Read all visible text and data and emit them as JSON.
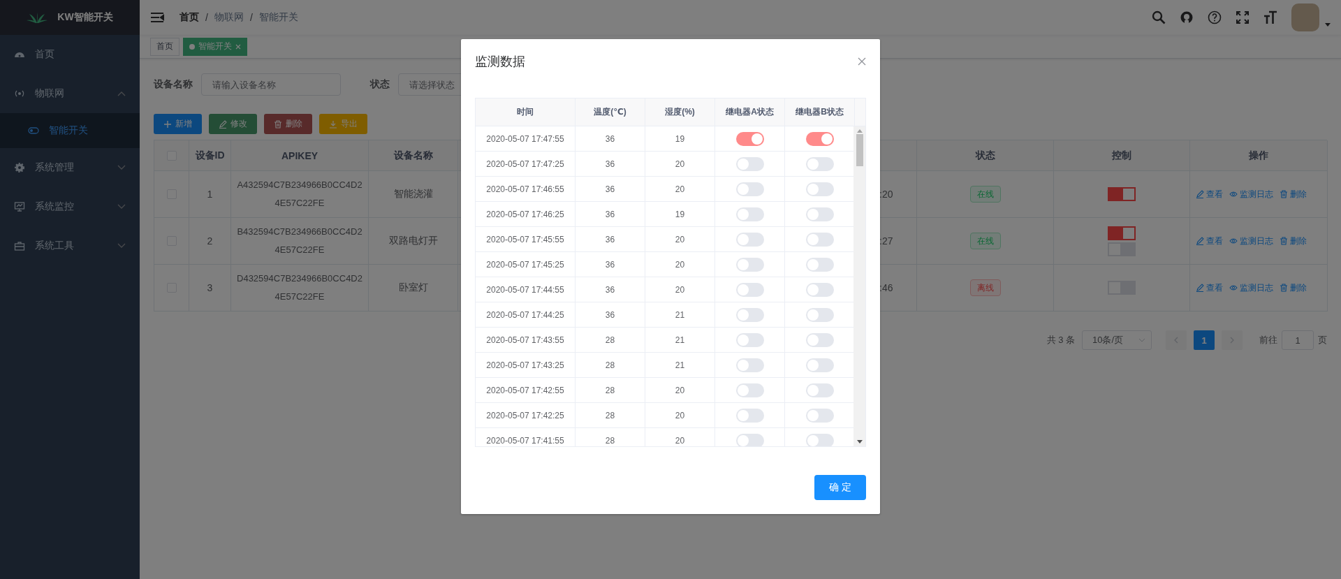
{
  "sidebar": {
    "logo_text": "KW智能开关",
    "items": [
      {
        "label": "首页",
        "selected": false
      },
      {
        "label": "物联网",
        "selected": false,
        "expanded": true,
        "children": [
          {
            "label": "智能开关",
            "selected": true
          }
        ]
      },
      {
        "label": "系统管理",
        "selected": false,
        "expanded": false
      },
      {
        "label": "系统监控",
        "selected": false,
        "expanded": false
      },
      {
        "label": "系统工具",
        "selected": false,
        "expanded": false
      }
    ]
  },
  "navbar": {
    "breadcrumb": [
      {
        "kind": "link",
        "label": "首页"
      },
      {
        "kind": "separator",
        "label": "/"
      },
      {
        "kind": "link",
        "label": "物联网"
      },
      {
        "kind": "separator",
        "label": "/"
      },
      {
        "kind": "link",
        "label": "智能开关"
      }
    ]
  },
  "tags": [
    {
      "label": "首页",
      "selected": false
    },
    {
      "label": "智能开关",
      "selected": true
    }
  ],
  "search_form": {
    "fields": [
      {
        "label": "设备名称",
        "placeholder": "请输入设备名称"
      },
      {
        "label": "状态",
        "placeholder": "请选择状态"
      }
    ]
  },
  "toolbar": [
    {
      "label": "新增",
      "kind": "primary",
      "disabled": false
    },
    {
      "label": "修改",
      "kind": "success",
      "disabled": true
    },
    {
      "label": "删除",
      "kind": "danger",
      "disabled": true
    },
    {
      "label": "导出",
      "kind": "warning",
      "disabled": false
    }
  ],
  "table": {
    "all_checked": false,
    "columns": [
      "设备ID",
      "APIKEY",
      "设备名称",
      "",
      "",
      "状态",
      "控制",
      "操作"
    ],
    "rows": [
      {
        "checked": false,
        "id": "1",
        "apikey": "A432594C7B234966B0CC4D24E57C22FE",
        "name": "智能浇灌",
        "column_5": ":20",
        "status": {
          "label": "在线",
          "kind": "success"
        },
        "switches": [
          {
            "on": true
          }
        ],
        "actions": [
          {
            "label": "查看",
            "kind": "edit"
          },
          {
            "label": "监测日志",
            "kind": "view"
          },
          {
            "label": "删除",
            "kind": "delete"
          }
        ]
      },
      {
        "checked": false,
        "id": "2",
        "apikey": "B432594C7B234966B0CC4D24E57C22FE",
        "name": "双路电灯开",
        "column_5": ":27",
        "status": {
          "label": "在线",
          "kind": "success"
        },
        "switches": [
          {
            "on": true
          },
          {
            "on": false
          }
        ],
        "actions": [
          {
            "label": "查看",
            "kind": "edit"
          },
          {
            "label": "监测日志",
            "kind": "view"
          },
          {
            "label": "删除",
            "kind": "delete"
          }
        ]
      },
      {
        "checked": false,
        "id": "3",
        "apikey": "D432594C7B234966B0CC4D24E57C22FE",
        "name": "卧室灯",
        "column_5": ":46",
        "status": {
          "label": "离线",
          "kind": "danger"
        },
        "switches": [
          {
            "on": false
          }
        ],
        "actions": [
          {
            "label": "查看",
            "kind": "edit"
          },
          {
            "label": "监测日志",
            "kind": "view"
          },
          {
            "label": "删除",
            "kind": "delete"
          }
        ]
      }
    ]
  },
  "pagination": {
    "total": "共 3 条",
    "page_size": "10条/页",
    "pages": [
      {
        "label": "1",
        "selected": true
      }
    ],
    "goto_label": "前往",
    "goto_value": "1",
    "goto_suffix": "页"
  },
  "dialog": {
    "title": "监测数据",
    "columns": [
      "时间",
      "温度(℃)",
      "湿度(%)",
      "继电器A状态",
      "继电器B状态"
    ],
    "rows": [
      {
        "time": "2020-05-07 17:47:55",
        "temperature": "36",
        "humidity": "19",
        "relay_a": true,
        "relay_b": true
      },
      {
        "time": "2020-05-07 17:47:25",
        "temperature": "36",
        "humidity": "20",
        "relay_a": false,
        "relay_b": false
      },
      {
        "time": "2020-05-07 17:46:55",
        "temperature": "36",
        "humidity": "20",
        "relay_a": false,
        "relay_b": false
      },
      {
        "time": "2020-05-07 17:46:25",
        "temperature": "36",
        "humidity": "19",
        "relay_a": false,
        "relay_b": false
      },
      {
        "time": "2020-05-07 17:45:55",
        "temperature": "36",
        "humidity": "20",
        "relay_a": false,
        "relay_b": false
      },
      {
        "time": "2020-05-07 17:45:25",
        "temperature": "36",
        "humidity": "20",
        "relay_a": false,
        "relay_b": false
      },
      {
        "time": "2020-05-07 17:44:55",
        "temperature": "36",
        "humidity": "20",
        "relay_a": false,
        "relay_b": false
      },
      {
        "time": "2020-05-07 17:44:25",
        "temperature": "36",
        "humidity": "21",
        "relay_a": false,
        "relay_b": false
      },
      {
        "time": "2020-05-07 17:43:55",
        "temperature": "28",
        "humidity": "21",
        "relay_a": false,
        "relay_b": false
      },
      {
        "time": "2020-05-07 17:43:25",
        "temperature": "28",
        "humidity": "21",
        "relay_a": false,
        "relay_b": false
      },
      {
        "time": "2020-05-07 17:42:55",
        "temperature": "28",
        "humidity": "20",
        "relay_a": false,
        "relay_b": false
      },
      {
        "time": "2020-05-07 17:42:25",
        "temperature": "28",
        "humidity": "20",
        "relay_a": false,
        "relay_b": false
      },
      {
        "time": "2020-05-07 17:41:55",
        "temperature": "28",
        "humidity": "20",
        "relay_a": false,
        "relay_b": false
      }
    ],
    "confirm_button": "确 定"
  }
}
